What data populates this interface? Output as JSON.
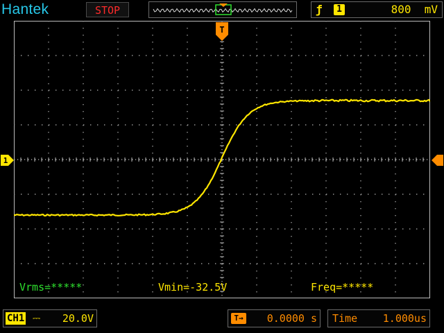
{
  "header": {
    "brand": "Hantek",
    "run_state": "STOP",
    "trigger": {
      "slope_icon": "rising-edge-icon",
      "slope_glyph": "ƒ",
      "channel": "1",
      "level": "800  mV"
    }
  },
  "markers": {
    "trigger_position": "T",
    "channel_ground": "1"
  },
  "measurements": {
    "vrms": "Vrms=*****",
    "vmin": "Vmin=-32.5V",
    "freq": "Freq=*****"
  },
  "footer": {
    "channel": {
      "tag": "CH1",
      "coupling_glyph": "⎓",
      "scale": "20.0V"
    },
    "trigger_position": {
      "tag": "T→",
      "value": "0.0000 s"
    },
    "timebase": {
      "label": "Time",
      "value": "1.000us"
    }
  },
  "colors": {
    "background": "#000000",
    "trace": "#ffe600",
    "brand": "#27c7e8",
    "stop": "#ff2a2a",
    "accent": "#ff8c00",
    "measurement_green": "#2ee02e",
    "grid": "#9a9a9a"
  }
}
